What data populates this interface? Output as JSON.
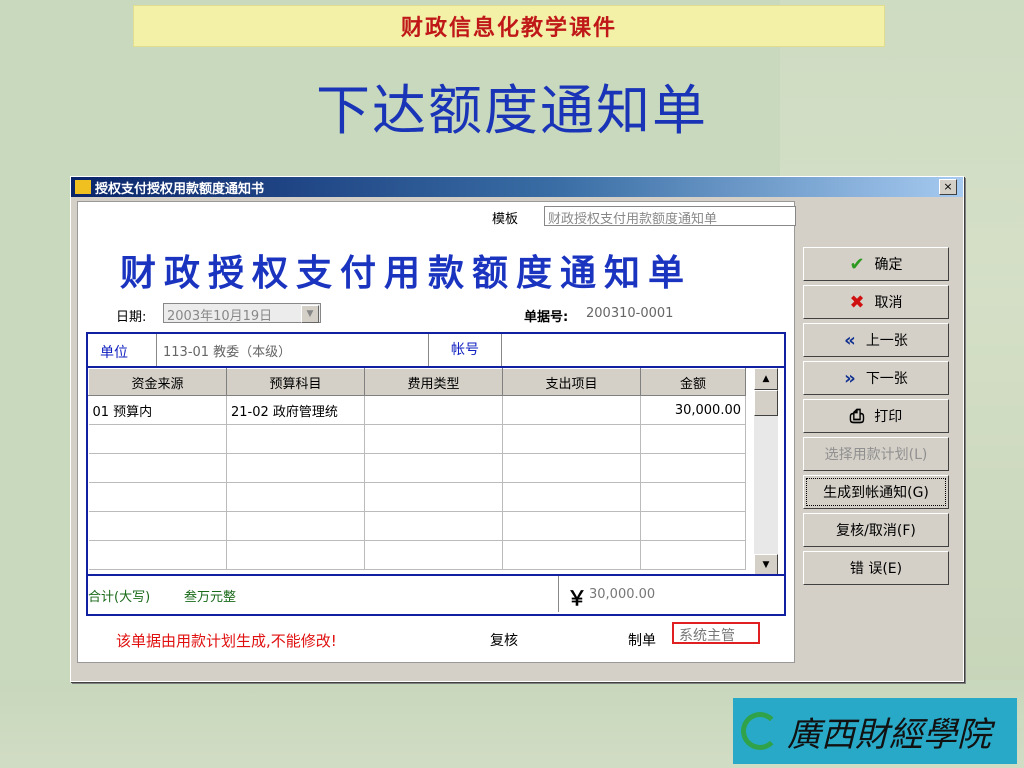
{
  "slide": {
    "header": "财政信息化教学课件",
    "title": "下达额度通知单",
    "logo_text": "廣西財經學院"
  },
  "window": {
    "title": "授权支付授权用款额度通知书",
    "close_label": "×"
  },
  "form": {
    "template_label": "模板",
    "template_value": "财政授权支付用款额度通知单",
    "title": "财政授权支付用款额度通知单",
    "date_label": "日期:",
    "date_value": "2003年10月19日",
    "docno_label": "单据号:",
    "docno_value": "200310-0001",
    "unit_label": "单位",
    "unit_value": "113-01 教委（本级）",
    "account_label": "帐号",
    "columns": [
      "资金来源",
      "预算科目",
      "费用类型",
      "支出项目",
      "金额"
    ],
    "rows": [
      [
        "01 预算内",
        "21-02 政府管理统",
        "",
        "",
        "30,000.00"
      ],
      [
        "",
        "",
        "",
        "",
        ""
      ],
      [
        "",
        "",
        "",
        "",
        ""
      ],
      [
        "",
        "",
        "",
        "",
        ""
      ],
      [
        "",
        "",
        "",
        "",
        ""
      ],
      [
        "",
        "",
        "",
        "",
        ""
      ]
    ],
    "total_label": "合计(大写)",
    "total_capital": "叁万元整",
    "yen_symbol": "￥",
    "total_value": "30,000.00",
    "warning": "该单据由用款计划生成,不能修改!",
    "review_label": "复核",
    "maker_label": "制单",
    "maker_value": "系统主管"
  },
  "buttons": {
    "confirm": "确定",
    "cancel": "取消",
    "prev": "上一张",
    "next": "下一张",
    "print": "打印",
    "select_plan": "选择用款计划(L)",
    "generate": "生成到帐通知(G)",
    "review_cancel": "复核/取消(F)",
    "error": "错 误(E)"
  },
  "colors": {
    "title_blue": "#1a34b8",
    "header_red": "#c01818",
    "warning_red": "#e01010",
    "grid_border": "#1020a0"
  }
}
